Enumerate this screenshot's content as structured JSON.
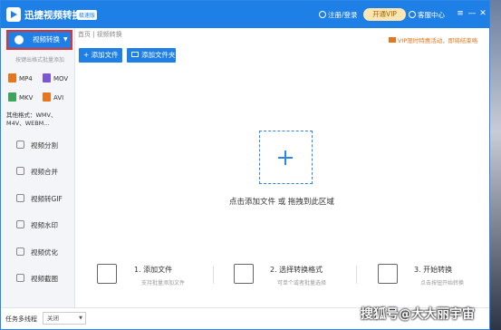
{
  "app": {
    "title": "迅捷视频转换器",
    "badge": "极速版",
    "login": "注册/登录",
    "vip_button": "开通VIP",
    "service": "客服中心",
    "controls": [
      "≡",
      "—",
      "✕"
    ]
  },
  "sidebar": {
    "convert_button": "视频转换",
    "hint": "按键出格式批量添加",
    "formats": [
      {
        "label": "MP4",
        "color": "#e6761e"
      },
      {
        "label": "MOV",
        "color": "#7b55d6"
      },
      {
        "label": "MKV",
        "color": "#3da35d"
      },
      {
        "label": "AVI",
        "color": "#e6761e"
      }
    ],
    "other_formats": "其他格式：WMV、M4V、WEBM…",
    "menu": [
      {
        "label": "视频分割",
        "icon": "split-icon"
      },
      {
        "label": "视频合并",
        "icon": "merge-icon"
      },
      {
        "label": "视频转GIF",
        "icon": "gif-icon"
      },
      {
        "label": "视频水印",
        "icon": "watermark-icon"
      },
      {
        "label": "视频优化",
        "icon": "optimize-icon"
      },
      {
        "label": "视频截图",
        "icon": "screenshot-icon"
      }
    ]
  },
  "main": {
    "breadcrumb": "首页 | 视频转换",
    "promo": "VIP限时特惠活动，即将结束咯",
    "add_file": "+ 添加文件",
    "add_folder": "添加文件夹",
    "drop_text": "点击添加文件 或 拖拽到此区域",
    "steps": [
      {
        "title": "1. 添加文件",
        "desc": "支持批量添加文件"
      },
      {
        "title": "2. 选择转换格式",
        "desc": "可单个或者批量选择"
      },
      {
        "title": "3. 开始转换",
        "desc": "点击按钮开始转换"
      }
    ]
  },
  "statusbar": {
    "label": "任务多线程",
    "select_value": "关闭"
  },
  "watermark": "搜狐号@大大丽宇宙"
}
